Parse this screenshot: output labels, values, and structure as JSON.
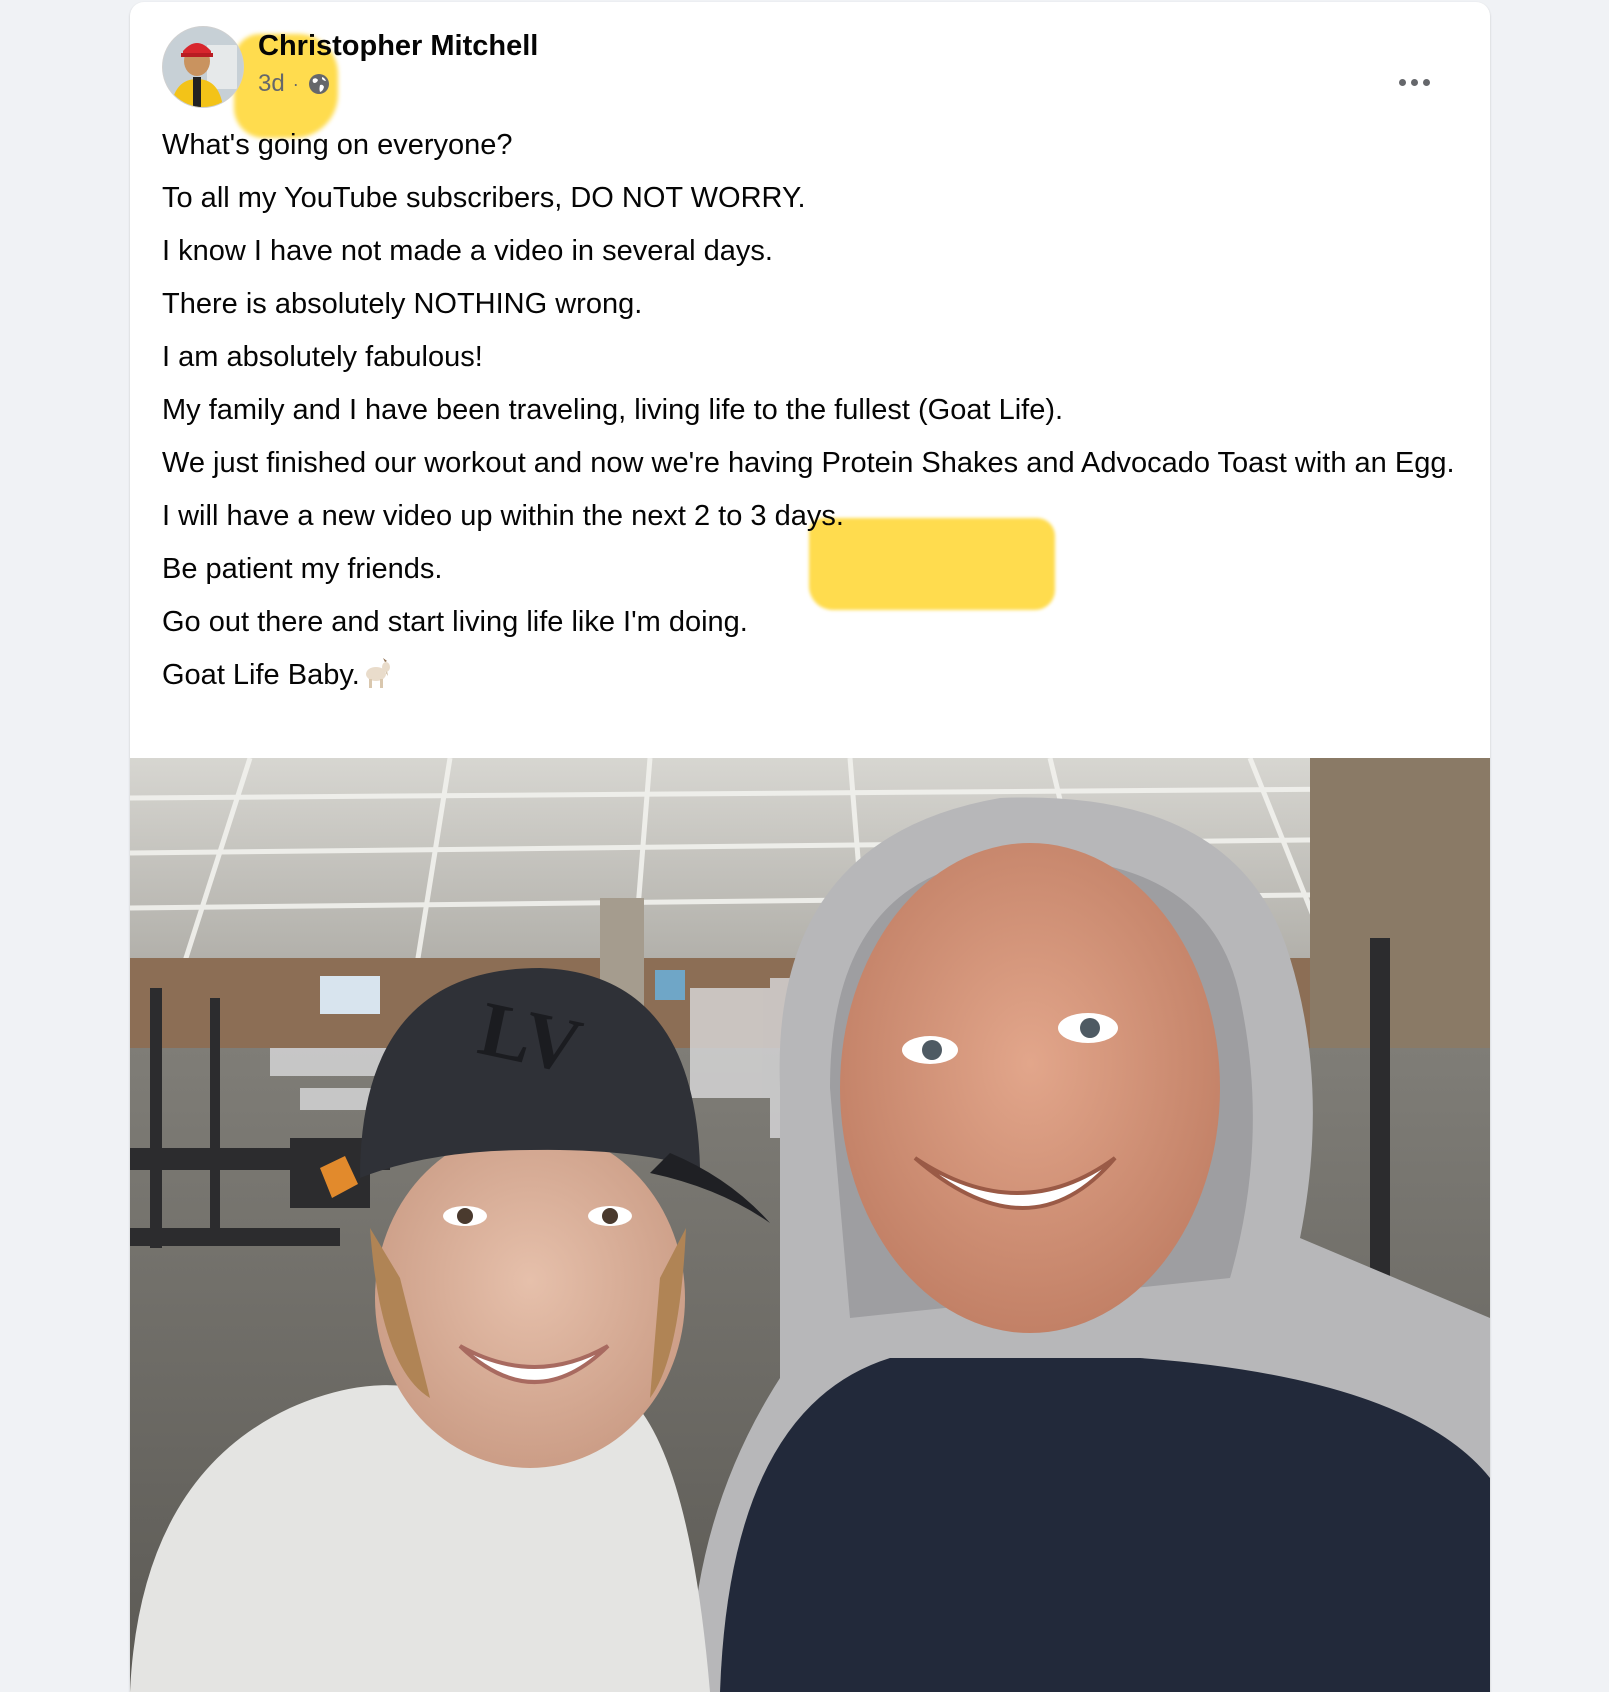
{
  "post": {
    "author": "Christopher Mitchell",
    "timestamp": "3d",
    "separator": "·",
    "privacy_icon": "globe-icon",
    "more_icon": "more-horizontal-icon",
    "lines": [
      "What's going on everyone?",
      "To all my YouTube subscribers, DO NOT WORRY.",
      "I know I have not made a video in several days.",
      "There is absolutely NOTHING wrong.",
      "I am absolutely fabulous!",
      "My family and I have been traveling, living life to the fullest (Goat Life).",
      "We just finished our workout and now we're having Protein Shakes and Advocado Toast with an Egg.",
      "I will have a new video up within the next 2 to 3 days.",
      "Be patient my friends.",
      "Go out there and start living life like I'm doing.",
      "Goat Life Baby."
    ],
    "emoji": "goat-emoji",
    "photo": {
      "cap_text": "LV"
    }
  },
  "colors": {
    "highlight": "#ffce0a",
    "text": "#050505",
    "secondary_text": "#65676b",
    "card_bg": "#ffffff",
    "page_bg": "#f0f2f5"
  }
}
